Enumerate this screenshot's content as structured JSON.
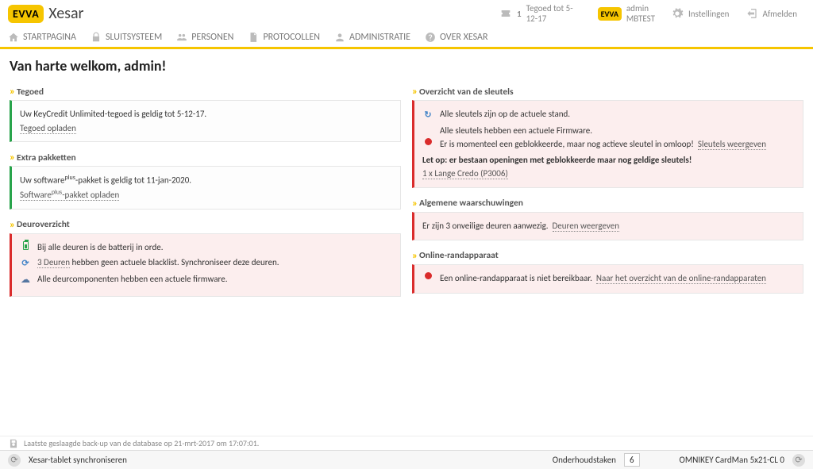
{
  "brand": {
    "badge": "EVVA",
    "product": "Xesar"
  },
  "header": {
    "credit_count": "1",
    "credit_text": "Tegoed tot 5-12-17",
    "badge2": "EVVA",
    "user_line1": "admin",
    "user_line2": "MBTEST",
    "settings": "Instellingen",
    "logout": "Afmelden"
  },
  "nav": {
    "home": "STARTPAGINA",
    "locking": "SLUITSYSTEEM",
    "persons": "PERSONEN",
    "protocols": "PROTOCOLLEN",
    "admin": "ADMINISTRATIE",
    "about": "OVER XESAR"
  },
  "welcome": "Van harte welkom, admin!",
  "left": {
    "credit": {
      "title": "Tegoed",
      "line1": "Uw KeyCredit Unlimited-tegoed is geldig tot 5-12-17.",
      "link": "Tegoed opladen"
    },
    "packages": {
      "title": "Extra pakketten",
      "line1a": "Uw software",
      "line1b": "-pakket is geldig tot 11-jan-2020.",
      "link_a": "Software",
      "link_b": "-pakket opladen",
      "sup": "plus"
    },
    "doors": {
      "title": "Deuroverzicht",
      "row1": "Bij alle deuren is de batterij in orde.",
      "row2_link": "3 Deuren",
      "row2_rest": " hebben geen actuele blacklist. Synchroniseer deze deuren.",
      "row3": "Alle deurcomponenten hebben een actuele firmware."
    }
  },
  "right": {
    "keys": {
      "title": "Overzicht van de sleutels",
      "row1": "Alle sleutels zijn op de actuele stand.",
      "row2": "Alle sleutels hebben een actuele Firmware.",
      "row3_text": "Er is momenteel een geblokkeerde, maar nog actieve sleutel in omloop!",
      "row3_link": "Sleutels weergeven",
      "row4": "Let op: er bestaan openingen met geblokkeerde maar nog geldige sleutels!",
      "row5_link": "1 x Lange Credo (P3006)"
    },
    "warn": {
      "title": "Algemene waarschuwingen",
      "text": "Er zijn 3 onveilige deuren aanwezig.",
      "link": "Deuren weergeven"
    },
    "online": {
      "title": "Online-randapparaat",
      "text": "Een online-randapparaat is niet bereikbaar.",
      "link": "Naar het overzicht van de online-randapparaten"
    }
  },
  "footer": {
    "backup": "Laatste geslaagde back-up van de database op 21-mrt-2017 om 17:07:01.",
    "sync": "Xesar-tablet synchroniseren",
    "maint": "Onderhoudstaken",
    "maint_count": "6",
    "reader": "OMNIKEY CardMan 5x21-CL 0"
  }
}
